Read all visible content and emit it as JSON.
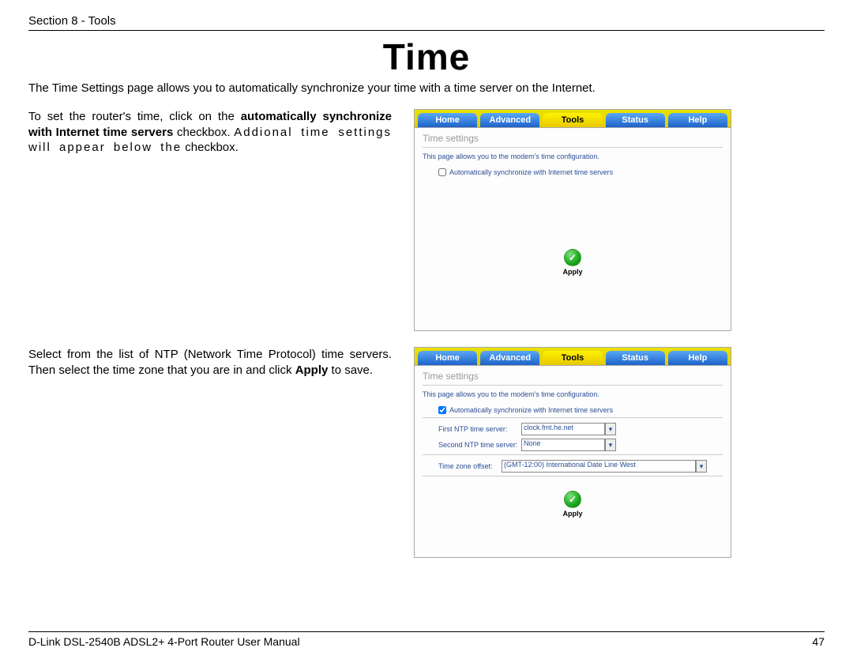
{
  "header": {
    "section": "Section 8 - Tools"
  },
  "title": "Time",
  "intro": "The Time Settings page allows you to automatically synchronize your time with a time server on the Internet.",
  "block1": {
    "pre": "To set the router's time, click on the ",
    "bold": "automatically synchronize with Internet time servers",
    "mid": " checkbox. ",
    "spaced": "Addional time settings will appear below the",
    "post": " checkbox."
  },
  "block2": {
    "pre": "Select from the list of NTP (Network Time Protocol) time servers. Then select the time zone that you are in and click ",
    "bold": "Apply",
    "post": " to save."
  },
  "panel": {
    "tabs": {
      "home": "Home",
      "advanced": "Advanced",
      "tools": "Tools",
      "status": "Status",
      "help": "Help"
    },
    "title": "Time settings",
    "desc": "This page allows you to the modem's time configuration.",
    "auto_sync_label": "Automatically synchronize with Internet time servers",
    "first_label": "First NTP time server:",
    "first_value": "clock.fmt.he.net",
    "second_label": "Second NTP time server:",
    "second_value": "None",
    "tz_label": "Time zone offset:",
    "tz_value": "(GMT-12:00) International Date Line West",
    "apply": "Apply"
  },
  "footer": {
    "manual": "D-Link DSL-2540B ADSL2+ 4-Port Router User Manual",
    "page": "47"
  }
}
